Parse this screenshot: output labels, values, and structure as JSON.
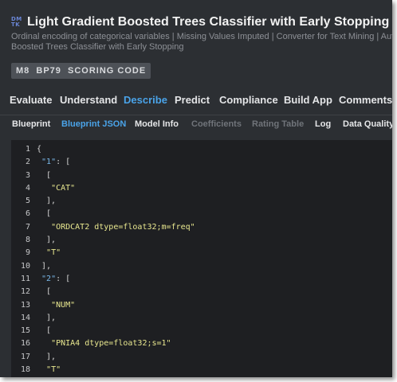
{
  "header": {
    "logo_top": "DM",
    "logo_bottom": "TK",
    "title": "Light Gradient Boosted Trees Classifier with Early Stopping",
    "subtitle_line1": "Ordinal encoding of categorical variables | Missing Values Imputed | Converter for Text Mining | Auto",
    "subtitle_line2": "Boosted Trees Classifier with Early Stopping",
    "badge": "M8  BP79  SCORING CODE"
  },
  "main_tabs": [
    {
      "label": "Evaluate"
    },
    {
      "label": "Understand"
    },
    {
      "label": "Describe"
    },
    {
      "label": "Predict"
    },
    {
      "label": "Compliance"
    },
    {
      "label": "Build App"
    },
    {
      "label": "Comments"
    }
  ],
  "main_active": "Describe",
  "sub_tabs": [
    {
      "label": "Blueprint"
    },
    {
      "label": "Blueprint JSON"
    },
    {
      "label": "Model Info"
    },
    {
      "label": "Coefficients"
    },
    {
      "label": "Rating Table"
    },
    {
      "label": "Log"
    },
    {
      "label": "Data Quality"
    }
  ],
  "sub_active": "Blueprint JSON",
  "sub_disabled": [
    "Coefficients",
    "Rating Table"
  ],
  "code_lines": [
    {
      "n": "1",
      "parts": [
        [
          "p",
          "{"
        ]
      ]
    },
    {
      "n": "2",
      "parts": [
        [
          "p",
          " "
        ],
        [
          "k",
          "\"1\""
        ],
        [
          "p",
          ": ["
        ]
      ]
    },
    {
      "n": "3",
      "parts": [
        [
          "p",
          "  ["
        ]
      ]
    },
    {
      "n": "4",
      "parts": [
        [
          "p",
          "   "
        ],
        [
          "s",
          "\"CAT\""
        ]
      ]
    },
    {
      "n": "5",
      "parts": [
        [
          "p",
          "  ],"
        ]
      ]
    },
    {
      "n": "6",
      "parts": [
        [
          "p",
          "  ["
        ]
      ]
    },
    {
      "n": "7",
      "parts": [
        [
          "p",
          "   "
        ],
        [
          "s",
          "\"ORDCAT2 dtype=float32;m=freq\""
        ]
      ]
    },
    {
      "n": "8",
      "parts": [
        [
          "p",
          "  ],"
        ]
      ]
    },
    {
      "n": "9",
      "parts": [
        [
          "p",
          "  "
        ],
        [
          "s",
          "\"T\""
        ]
      ]
    },
    {
      "n": "10",
      "parts": [
        [
          "p",
          " ],"
        ]
      ]
    },
    {
      "n": "11",
      "parts": [
        [
          "p",
          " "
        ],
        [
          "k",
          "\"2\""
        ],
        [
          "p",
          ": ["
        ]
      ]
    },
    {
      "n": "12",
      "parts": [
        [
          "p",
          "  ["
        ]
      ]
    },
    {
      "n": "13",
      "parts": [
        [
          "p",
          "   "
        ],
        [
          "s",
          "\"NUM\""
        ]
      ]
    },
    {
      "n": "14",
      "parts": [
        [
          "p",
          "  ],"
        ]
      ]
    },
    {
      "n": "15",
      "parts": [
        [
          "p",
          "  ["
        ]
      ]
    },
    {
      "n": "16",
      "parts": [
        [
          "p",
          "   "
        ],
        [
          "s",
          "\"PNIA4 dtype=float32;s=1\""
        ]
      ]
    },
    {
      "n": "17",
      "parts": [
        [
          "p",
          "  ],"
        ]
      ]
    },
    {
      "n": "18",
      "parts": [
        [
          "p",
          "  "
        ],
        [
          "s",
          "\"T\""
        ]
      ]
    }
  ],
  "colors": {
    "accent": "#4aa3e8",
    "string": "#e8e78f",
    "key": "#79b8ea",
    "background": "#2c2f33",
    "editor": "#1e1f22"
  }
}
